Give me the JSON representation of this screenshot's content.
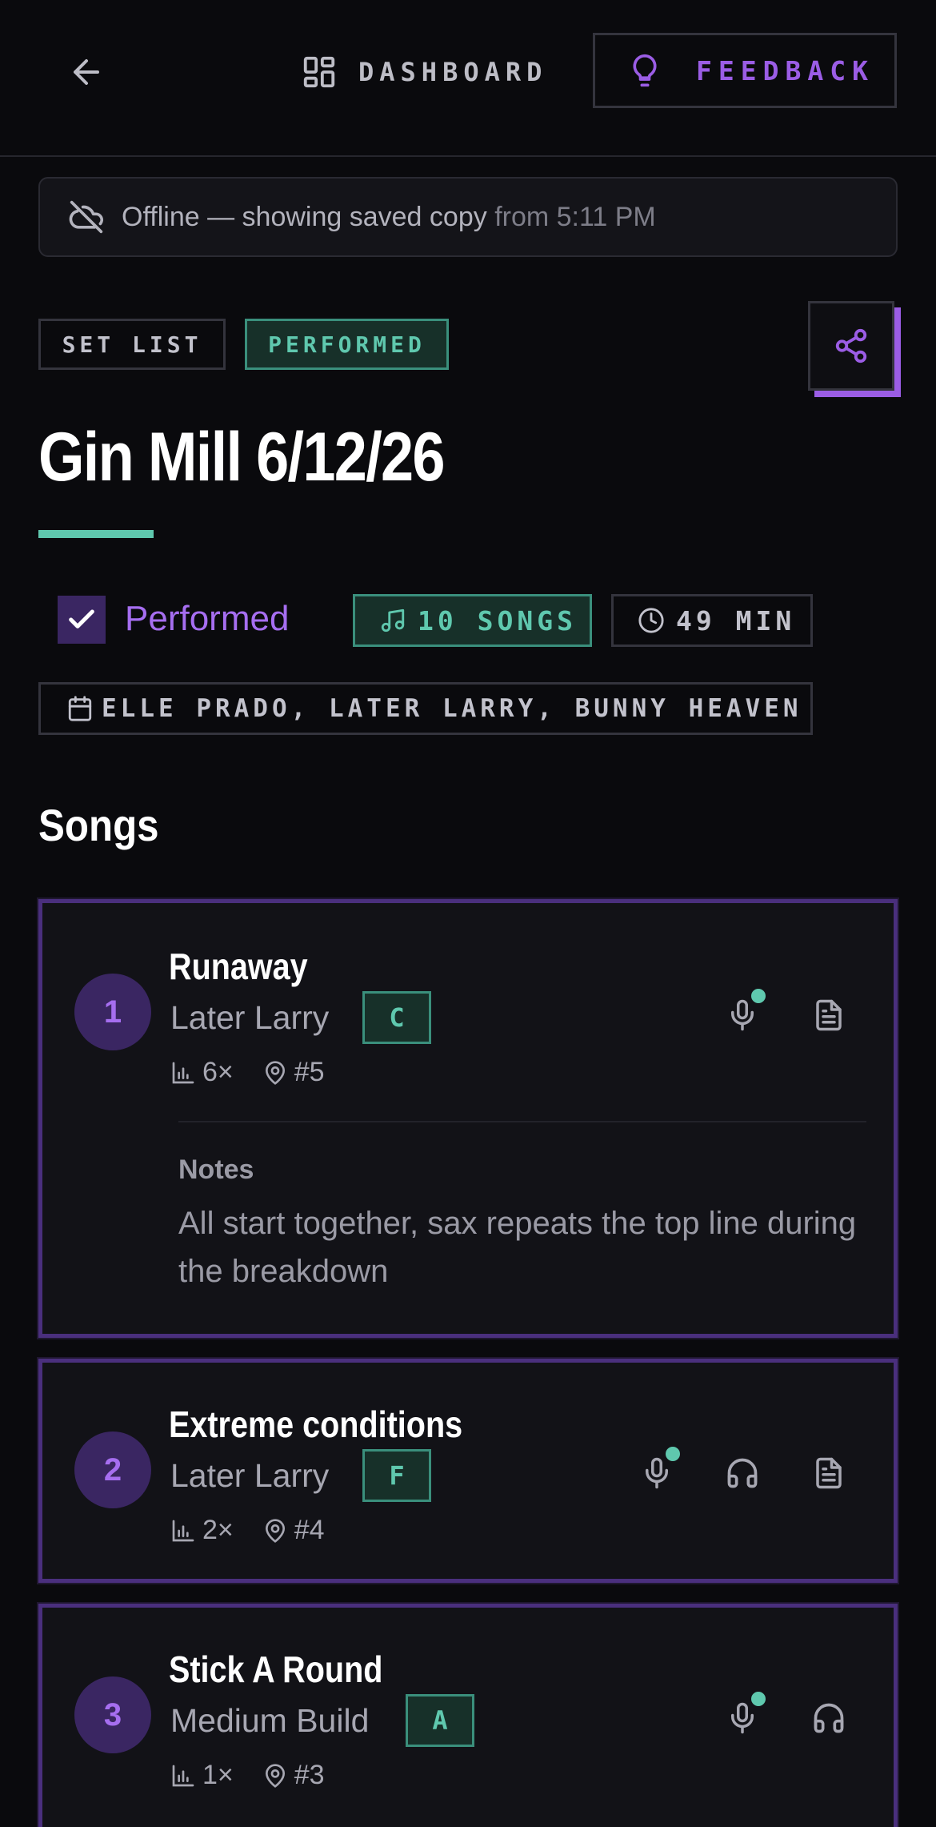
{
  "header": {
    "dashboard_label": "DASHBOARD",
    "feedback_label": "FEEDBACK",
    "icons": {
      "back": "arrow-left-icon",
      "dashboard": "dashboard-grid-icon",
      "feedback": "lightbulb-icon"
    }
  },
  "offline_banner": {
    "text": "Offline — showing saved copy",
    "time": "from 5:11 PM",
    "icon": "cloud-off-icon"
  },
  "tags": {
    "type": "SET LIST",
    "status": "PERFORMED"
  },
  "setlist": {
    "title": "Gin Mill 6/12/26",
    "performed_label": "Performed",
    "performed_checked": true,
    "songs_count": "10 SONGS",
    "duration": "49 MIN",
    "artists": "ELLE PRADO, LATER LARRY, BUNNY HEAVEN"
  },
  "songs_section": {
    "title": "Songs"
  },
  "songs": [
    {
      "number": "1",
      "title": "Runaway",
      "artist": "Later Larry",
      "key": "C",
      "plays": "6×",
      "position": "#5",
      "notes_label": "Notes",
      "notes": "All start together, sax repeats the top line during the breakdown",
      "icons": [
        "mic-icon",
        "document-icon"
      ]
    },
    {
      "number": "2",
      "title": "Extreme conditions",
      "artist": "Later Larry",
      "key": "F",
      "plays": "2×",
      "position": "#4",
      "icons": [
        "mic-icon",
        "headphones-icon",
        "document-icon"
      ]
    },
    {
      "number": "3",
      "title": "Stick A Round",
      "artist": "Medium Build",
      "key": "A",
      "plays": "1×",
      "position": "#3",
      "icons": [
        "mic-icon",
        "headphones-icon"
      ]
    }
  ],
  "colors": {
    "background": "#0a0a0d",
    "accent_purple": "#9b5de5",
    "accent_teal": "#5fc8ae",
    "card_border": "#4a2f7d"
  }
}
